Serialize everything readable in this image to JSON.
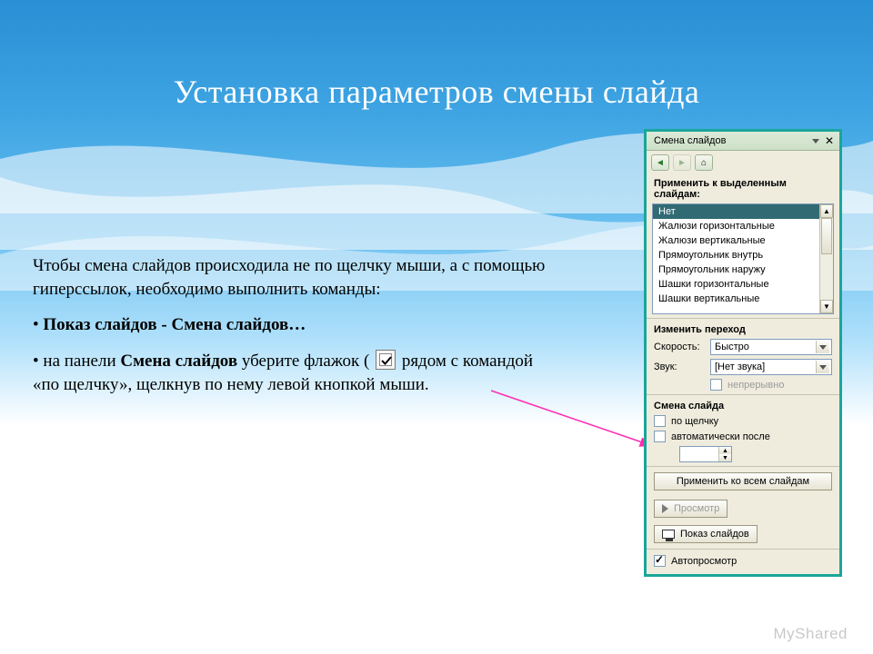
{
  "title": "Установка параметров смены слайда",
  "body": {
    "intro": "Чтобы смена слайдов происходила не по щелчку мыши, а с помощью гиперссылок, необходимо выполнить команды:",
    "bullet1_bold": "Показ слайдов - Смена слайдов…",
    "bullet2_pre": "на панели ",
    "bullet2_bold": "Смена слайдов",
    "bullet2_mid": " уберите флажок ( ",
    "bullet2_post": " рядом с командой «по щелчку», щелкнув по нему левой кнопкой мыши."
  },
  "panel": {
    "title": "Смена слайдов",
    "header_apply": "Применить к выделенным слайдам:",
    "transitions": [
      "Нет",
      "Жалюзи горизонтальные",
      "Жалюзи вертикальные",
      "Прямоугольник внутрь",
      "Прямоугольник наружу",
      "Шашки горизонтальные",
      "Шашки вертикальные"
    ],
    "section_modify": "Изменить переход",
    "speed_label": "Скорость:",
    "speed_value": "Быстро",
    "sound_label": "Звук:",
    "sound_value": "[Нет звука]",
    "loop_label": "непрерывно",
    "section_advance": "Смена слайда",
    "on_click": "по щелчку",
    "auto_after": "автоматически после",
    "apply_all": "Применить ко всем слайдам",
    "preview": "Просмотр",
    "slideshow": "Показ слайдов",
    "autopreview": "Автопросмотр"
  },
  "watermark": "MyShared"
}
